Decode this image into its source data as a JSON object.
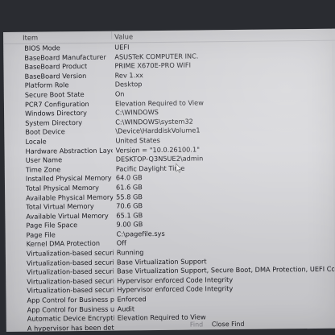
{
  "table": {
    "header": {
      "item": "Item",
      "value": "Value"
    },
    "rows": [
      {
        "item": "BIOS Mode",
        "value": "UEFI"
      },
      {
        "item": "BaseBoard Manufacturer",
        "value": "ASUSTeK COMPUTER INC."
      },
      {
        "item": "BaseBoard Product",
        "value": "PRIME X670E-PRO WIFI"
      },
      {
        "item": "BaseBoard Version",
        "value": "Rev 1.xx"
      },
      {
        "item": "Platform Role",
        "value": "Desktop"
      },
      {
        "item": "Secure Boot State",
        "value": "On"
      },
      {
        "item": "PCR7 Configuration",
        "value": "Elevation Required to View"
      },
      {
        "item": "Windows Directory",
        "value": "C:\\WINDOWS"
      },
      {
        "item": "System Directory",
        "value": "C:\\WINDOWS\\system32"
      },
      {
        "item": "Boot Device",
        "value": "\\Device\\HarddiskVolume1"
      },
      {
        "item": "Locale",
        "value": "United States"
      },
      {
        "item": "Hardware Abstraction Layer",
        "value": "Version = \"10.0.26100.1\""
      },
      {
        "item": "User Name",
        "value": "DESKTOP-Q3N5UE2\\admin"
      },
      {
        "item": "Time Zone",
        "value": "Pacific Daylight Time"
      },
      {
        "item": "Installed Physical Memory (RAM)",
        "value": "64.0 GB"
      },
      {
        "item": "Total Physical Memory",
        "value": "61.6 GB"
      },
      {
        "item": "Available Physical Memory",
        "value": "55.8 GB"
      },
      {
        "item": "Total Virtual Memory",
        "value": "70.6 GB"
      },
      {
        "item": "Available Virtual Memory",
        "value": "65.1 GB"
      },
      {
        "item": "Page File Space",
        "value": "9.00 GB"
      },
      {
        "item": "Page File",
        "value": "C:\\pagefile.sys"
      },
      {
        "item": "Kernel DMA Protection",
        "value": "Off"
      },
      {
        "item": "Virtualization-based security",
        "value": "Running"
      },
      {
        "item": "Virtualization-based security Re...",
        "value": "Base Virtualization Support"
      },
      {
        "item": "Virtualization-based security Av...",
        "value": "Base Virtualization Support, Secure Boot, DMA Protection, UEFI Code Readonl..."
      },
      {
        "item": "Virtualization-based security Se...",
        "value": "Hypervisor enforced Code Integrity"
      },
      {
        "item": "Virtualization-based security Se...",
        "value": "Hypervisor enforced Code Integrity"
      },
      {
        "item": "App Control for Business policy",
        "value": "Enforced"
      },
      {
        "item": "App Control for Business user ...",
        "value": "Audit"
      },
      {
        "item": "Automatic Device Encryption S...",
        "value": "Elevation Required to View"
      },
      {
        "item": "A hypervisor has been detected...",
        "value": ""
      }
    ]
  },
  "footer": {
    "find": "Find",
    "close_find": "Close Find"
  },
  "icons": {
    "cursor": "mouse-pointer-icon"
  }
}
